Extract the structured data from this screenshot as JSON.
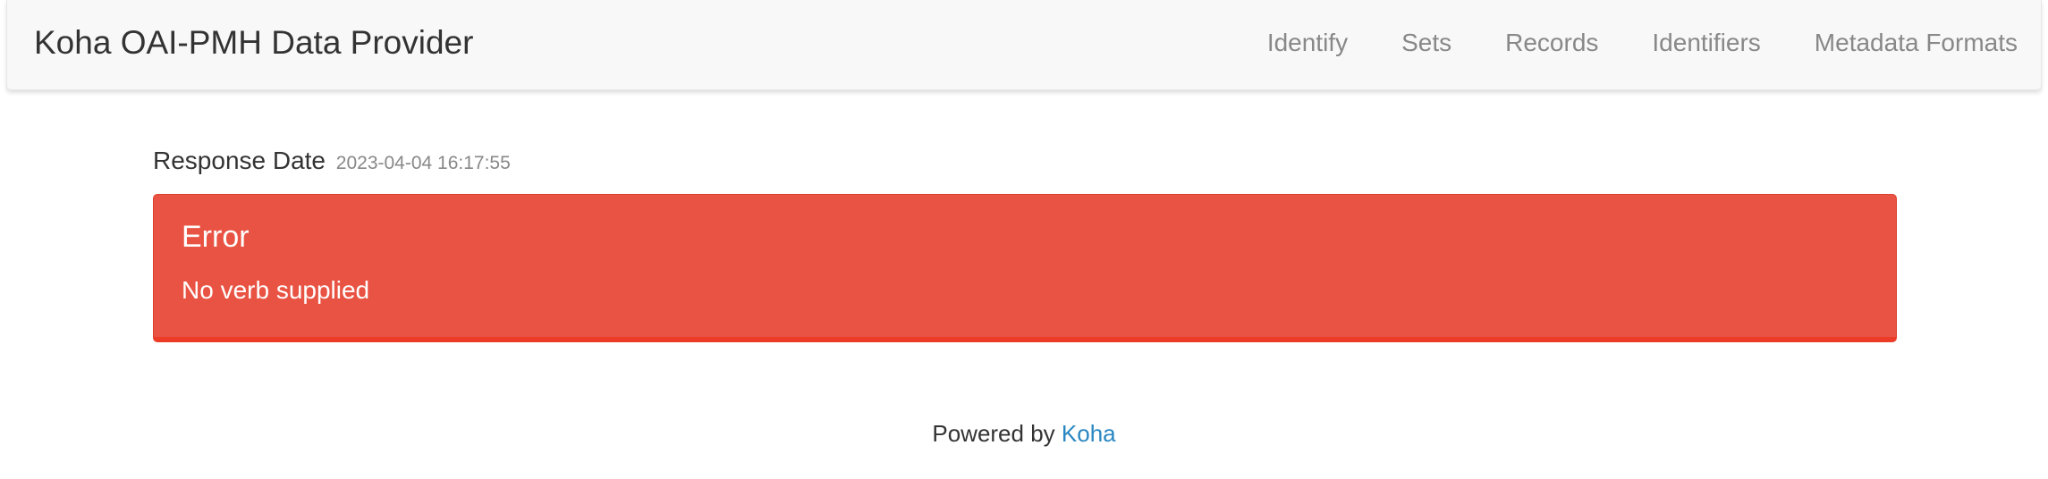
{
  "navbar": {
    "brand": "Koha OAI-PMH Data Provider",
    "items": [
      {
        "label": "Identify"
      },
      {
        "label": "Sets"
      },
      {
        "label": "Records"
      },
      {
        "label": "Identifiers"
      },
      {
        "label": "Metadata Formats"
      }
    ]
  },
  "response": {
    "label": "Response Date",
    "date": "2023-04-04 16:17:55"
  },
  "error": {
    "title": "Error",
    "message": "No verb supplied"
  },
  "footer": {
    "prefix": "Powered by",
    "link_label": "Koha"
  },
  "colors": {
    "error_background": "#e95343",
    "link": "#2a87c1"
  }
}
